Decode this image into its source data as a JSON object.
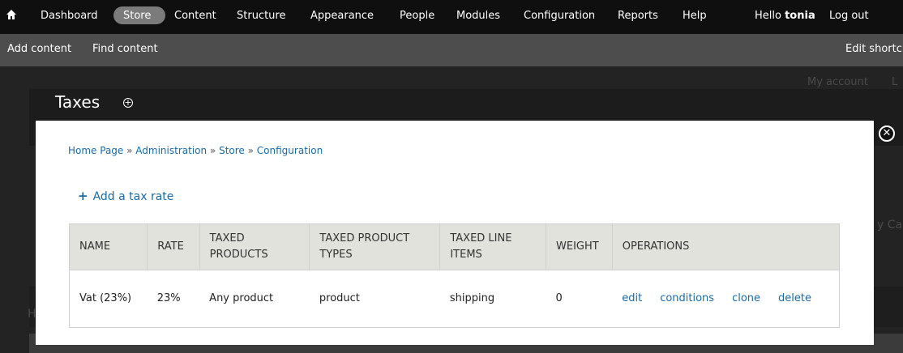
{
  "toolbar": {
    "items": [
      "Dashboard",
      "Store",
      "Content",
      "Structure",
      "Appearance",
      "People",
      "Modules",
      "Configuration",
      "Reports",
      "Help"
    ],
    "greeting": "Hello ",
    "username": "tonia",
    "logout": "Log out"
  },
  "shortcuts": {
    "add_content": "Add content",
    "find_content": "Find content",
    "edit_shortcuts": "Edit shortc"
  },
  "background": {
    "my_account": "My account",
    "partial_l": "L",
    "partial_cart": "y Ca",
    "partial_h": "H"
  },
  "page": {
    "title": "Taxes"
  },
  "overlay": {
    "breadcrumb": [
      "Home Page",
      "Administration",
      "Store",
      "Configuration"
    ],
    "separator": " » ",
    "add_link": "Add a tax rate",
    "table": {
      "headers": [
        "NAME",
        "RATE",
        "TAXED PRODUCTS",
        "TAXED PRODUCT TYPES",
        "TAXED LINE ITEMS",
        "WEIGHT",
        "OPERATIONS"
      ],
      "rows": [
        {
          "name": "Vat (23%)",
          "rate": "23%",
          "taxed_products": "Any product",
          "taxed_product_types": "product",
          "taxed_line_items": "shipping",
          "weight": "0",
          "operations": [
            "edit",
            "conditions",
            "clone",
            "delete"
          ]
        }
      ]
    }
  },
  "colors": {
    "link": "#1a6aa8",
    "toolbar_bg": "#0f0f0f",
    "shortcut_bg": "#4d4d4d",
    "header_bg": "#e1e2dc"
  }
}
